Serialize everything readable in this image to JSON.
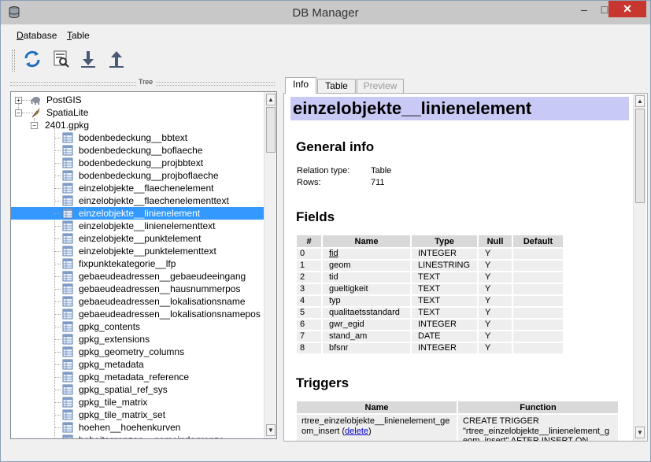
{
  "window": {
    "title": "DB Manager",
    "minimize": "–",
    "maximize": "□",
    "close": "✕"
  },
  "menubar": {
    "database": "Database",
    "database_mnemonic": "D",
    "database_rest": "atabase",
    "table_mnemonic": "T",
    "table_rest": "able"
  },
  "toolbar": {
    "icons": [
      "refresh-icon",
      "sql-window-icon",
      "import-layer-icon",
      "export-file-icon"
    ]
  },
  "tree": {
    "title": "Tree",
    "providers": [
      {
        "label": "PostGIS",
        "expander": "+"
      },
      {
        "label": "SpatiaLite",
        "expander": "−"
      }
    ],
    "database": {
      "label": "2401.gpkg",
      "expander": "−"
    },
    "items": [
      "bodenbedeckung__bbtext",
      "bodenbedeckung__boflaeche",
      "bodenbedeckung__projbbtext",
      "bodenbedeckung__projboflaeche",
      "einzelobjekte__flaechenelement",
      "einzelobjekte__flaechenelementtext",
      "einzelobjekte__linienelement",
      "einzelobjekte__linienelementtext",
      "einzelobjekte__punktelement",
      "einzelobjekte__punktelementtext",
      "fixpunktekategorie__lfp",
      "gebaeudeadressen__gebaeudeeingang",
      "gebaeudeadressen__hausnummerpos",
      "gebaeudeadressen__lokalisationsname",
      "gebaeudeadressen__lokalisationsnamepos",
      "gpkg_contents",
      "gpkg_extensions",
      "gpkg_geometry_columns",
      "gpkg_metadata",
      "gpkg_metadata_reference",
      "gpkg_spatial_ref_sys",
      "gpkg_tile_matrix",
      "gpkg_tile_matrix_set",
      "hoehen__hoehenkurven",
      "hoheitsgrenzen__gemeindegrenze"
    ],
    "selected_index": 6
  },
  "tabs": [
    "Info",
    "Table",
    "Preview"
  ],
  "info": {
    "heading": "einzelobjekte__linienelement",
    "general_title": "General info",
    "relation_type_label": "Relation type:",
    "relation_type_value": "Table",
    "rows_label": "Rows:",
    "rows_value": "711",
    "fields_title": "Fields",
    "fields_columns": [
      "#",
      "Name",
      "Type",
      "Null",
      "Default"
    ],
    "fields": [
      [
        "0",
        "fid",
        "INTEGER",
        "Y",
        ""
      ],
      [
        "1",
        "geom",
        "LINESTRING",
        "Y",
        ""
      ],
      [
        "2",
        "tid",
        "TEXT",
        "Y",
        ""
      ],
      [
        "3",
        "gueltigkeit",
        "TEXT",
        "Y",
        ""
      ],
      [
        "4",
        "typ",
        "TEXT",
        "Y",
        ""
      ],
      [
        "5",
        "qualitaetsstandard",
        "TEXT",
        "Y",
        ""
      ],
      [
        "6",
        "gwr_egid",
        "INTEGER",
        "Y",
        ""
      ],
      [
        "7",
        "stand_am",
        "DATE",
        "Y",
        ""
      ],
      [
        "8",
        "bfsnr",
        "INTEGER",
        "Y",
        ""
      ]
    ],
    "triggers_title": "Triggers",
    "triggers_columns": [
      "Name",
      "Function"
    ],
    "trigger_name_line1": "rtree_einzelobjekte__linienelement_ge",
    "trigger_name_line2": "om_insert (",
    "trigger_delete_link": "delete",
    "trigger_name_close": ")",
    "trigger_function_line1": "CREATE TRIGGER",
    "trigger_function_line2": "\"rtree_einzelobjekte__linienelement_g",
    "trigger_function_line3": "eom_insert\" AFTER INSERT ON"
  }
}
